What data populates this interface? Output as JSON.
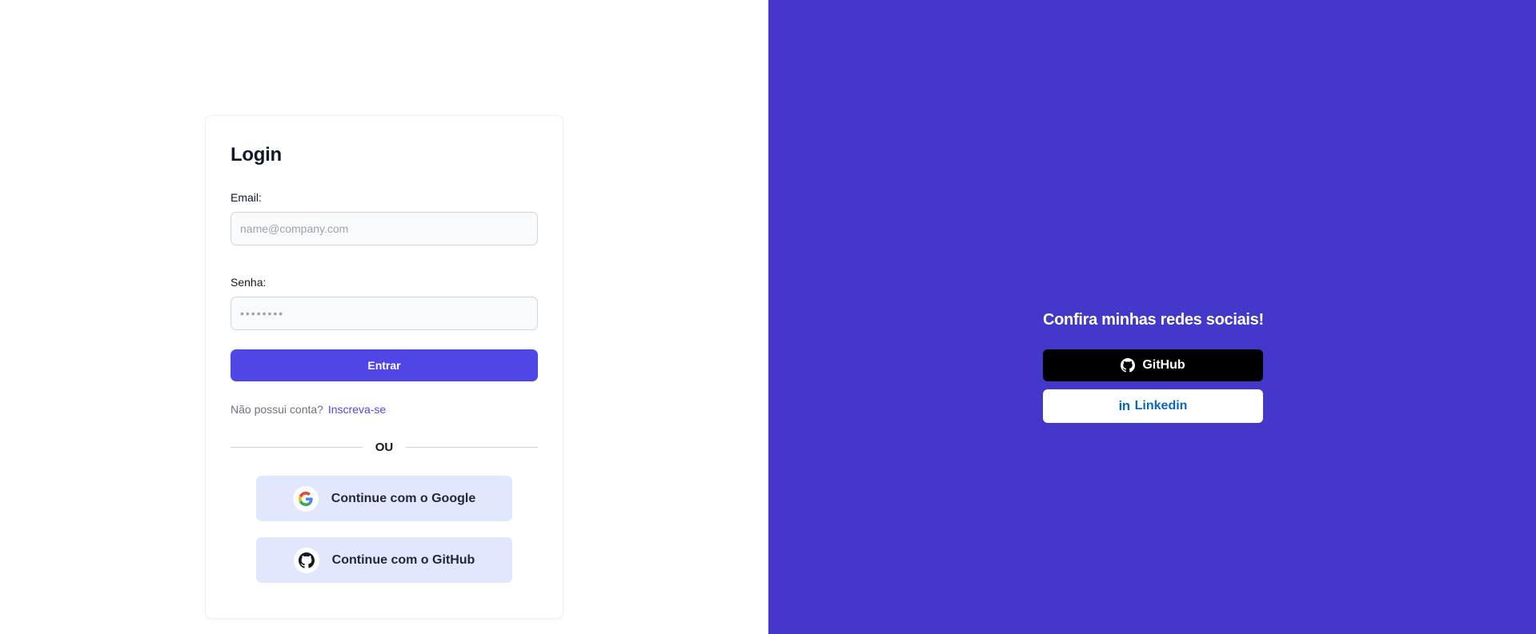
{
  "login": {
    "title": "Login",
    "email_label": "Email:",
    "email_placeholder": "name@company.com",
    "password_label": "Senha:",
    "password_placeholder": "••••••••",
    "submit_label": "Entrar",
    "no_account_text": "Não possui conta?",
    "signup_link": "Inscreva-se",
    "divider_text": "OU",
    "google_button_label": "Continue com o Google",
    "github_button_label": "Continue com o GitHub"
  },
  "social": {
    "heading": "Confira minhas redes sociais!",
    "github_label": "GitHub",
    "linkedin_label": "Linkedin",
    "linkedin_glyph": "in"
  },
  "colors": {
    "accent": "#4f46e5",
    "right_panel_bg": "#4338ca",
    "oauth_button_bg": "#e0e7ff",
    "linkedin_blue": "#0a66c2"
  },
  "icons": {
    "google": "google-icon",
    "github": "github-icon",
    "linkedin": "linkedin-icon"
  }
}
